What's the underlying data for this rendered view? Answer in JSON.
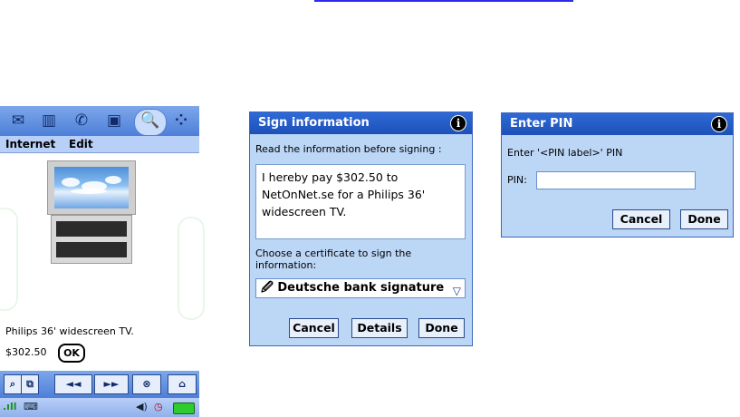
{
  "phone": {
    "menu": [
      "Internet",
      "Edit"
    ],
    "product_name": "Philips 36' widescreen TV.",
    "product_price": "$302.50",
    "ok_label": "OK",
    "toolbar": {
      "back_label": "◄◄",
      "forward_label": "►►"
    },
    "status_icons": [
      "signal-icon",
      "keyboard-icon",
      "speaker-icon",
      "clock-icon",
      "battery-icon"
    ]
  },
  "sign_dialog": {
    "title": "Sign information",
    "instruction": "Read the information before signing :",
    "message_lines": [
      "I hereby pay $302.50 to",
      "NetOnNet.se for a Philips 36'",
      "widescreen TV."
    ],
    "cert_prompt_lines": [
      "Choose a certificate to sign the",
      "information:"
    ],
    "certificate": "Deutsche bank signature",
    "cancel": "Cancel",
    "details": "Details",
    "done": "Done"
  },
  "pin_dialog": {
    "title": "Enter PIN",
    "prompt": "Enter '<PIN label>' PIN",
    "pin_label": "PIN:",
    "pin_value": "",
    "cancel": "Cancel",
    "done": "Done"
  },
  "colors": {
    "titlebar": "#1d50b8",
    "dialog_bg": "#bcd6f6",
    "link": "#2a2af0"
  }
}
